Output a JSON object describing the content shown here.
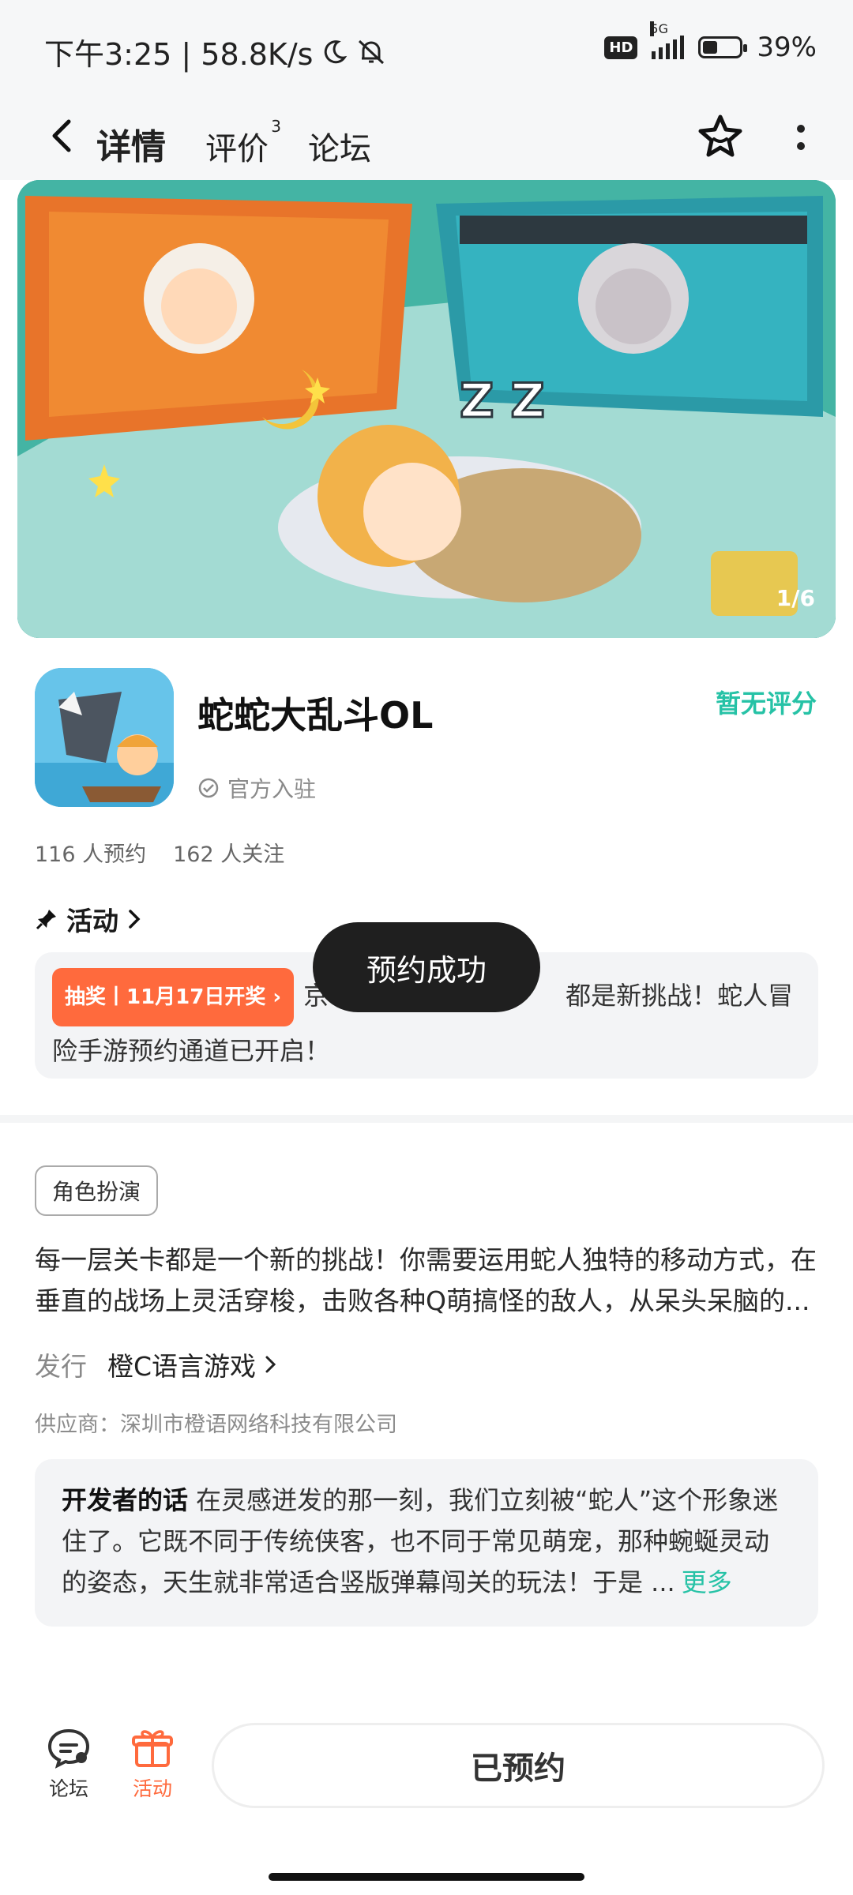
{
  "status_bar": {
    "time_speed": "下午3:25 | 58.8K/s",
    "battery": "39%",
    "battery_level": 0.39,
    "network": "5G",
    "hd": "HD"
  },
  "header": {
    "tabs": [
      {
        "label": "详情",
        "active": true
      },
      {
        "label": "评价",
        "badge": "3"
      },
      {
        "label": "论坛"
      }
    ]
  },
  "banner": {
    "counter": "1/6"
  },
  "game": {
    "title": "蛇蛇大乱斗OL",
    "official": "官方入驻",
    "rating": "暂无评分",
    "reservations": "116 人预约",
    "followers": "162 人关注"
  },
  "activity": {
    "header": "活动",
    "badge": "抽奖丨11月17日开奖",
    "text_prefix": "京",
    "text_suffix": "都是新挑战！蛇人冒险手游预约通道已开启！"
  },
  "toast": "预约成功",
  "details": {
    "genre": "角色扮演",
    "description": "每一层关卡都是一个新的挑战！你需要运用蛇人独特的移动方式，在垂直的战场上灵活穿梭，击败各种Q萌搞怪的敌人，从呆头呆脑的...",
    "publisher_label": "发行",
    "publisher": "橙C语言游戏",
    "supplier": "供应商：深圳市橙语网络科技有限公司"
  },
  "developer": {
    "label": "开发者的话",
    "text": "在灵感迸发的那一刻，我们立刻被“蛇人”这个形象迷住了。它既不同于传统侠客，也不同于常见萌宠，那种蜿蜒灵动的姿态，天生就非常适合竖版弹幕闯关的玩法！于是 ...",
    "more": "更多"
  },
  "bottom_nav": {
    "forum": "论坛",
    "event": "活动",
    "reserve": "已预约"
  },
  "colors": {
    "accent": "#26c2a6",
    "badge_orange": "#ff6a3d",
    "toast_bg": "#1f1f1f"
  }
}
